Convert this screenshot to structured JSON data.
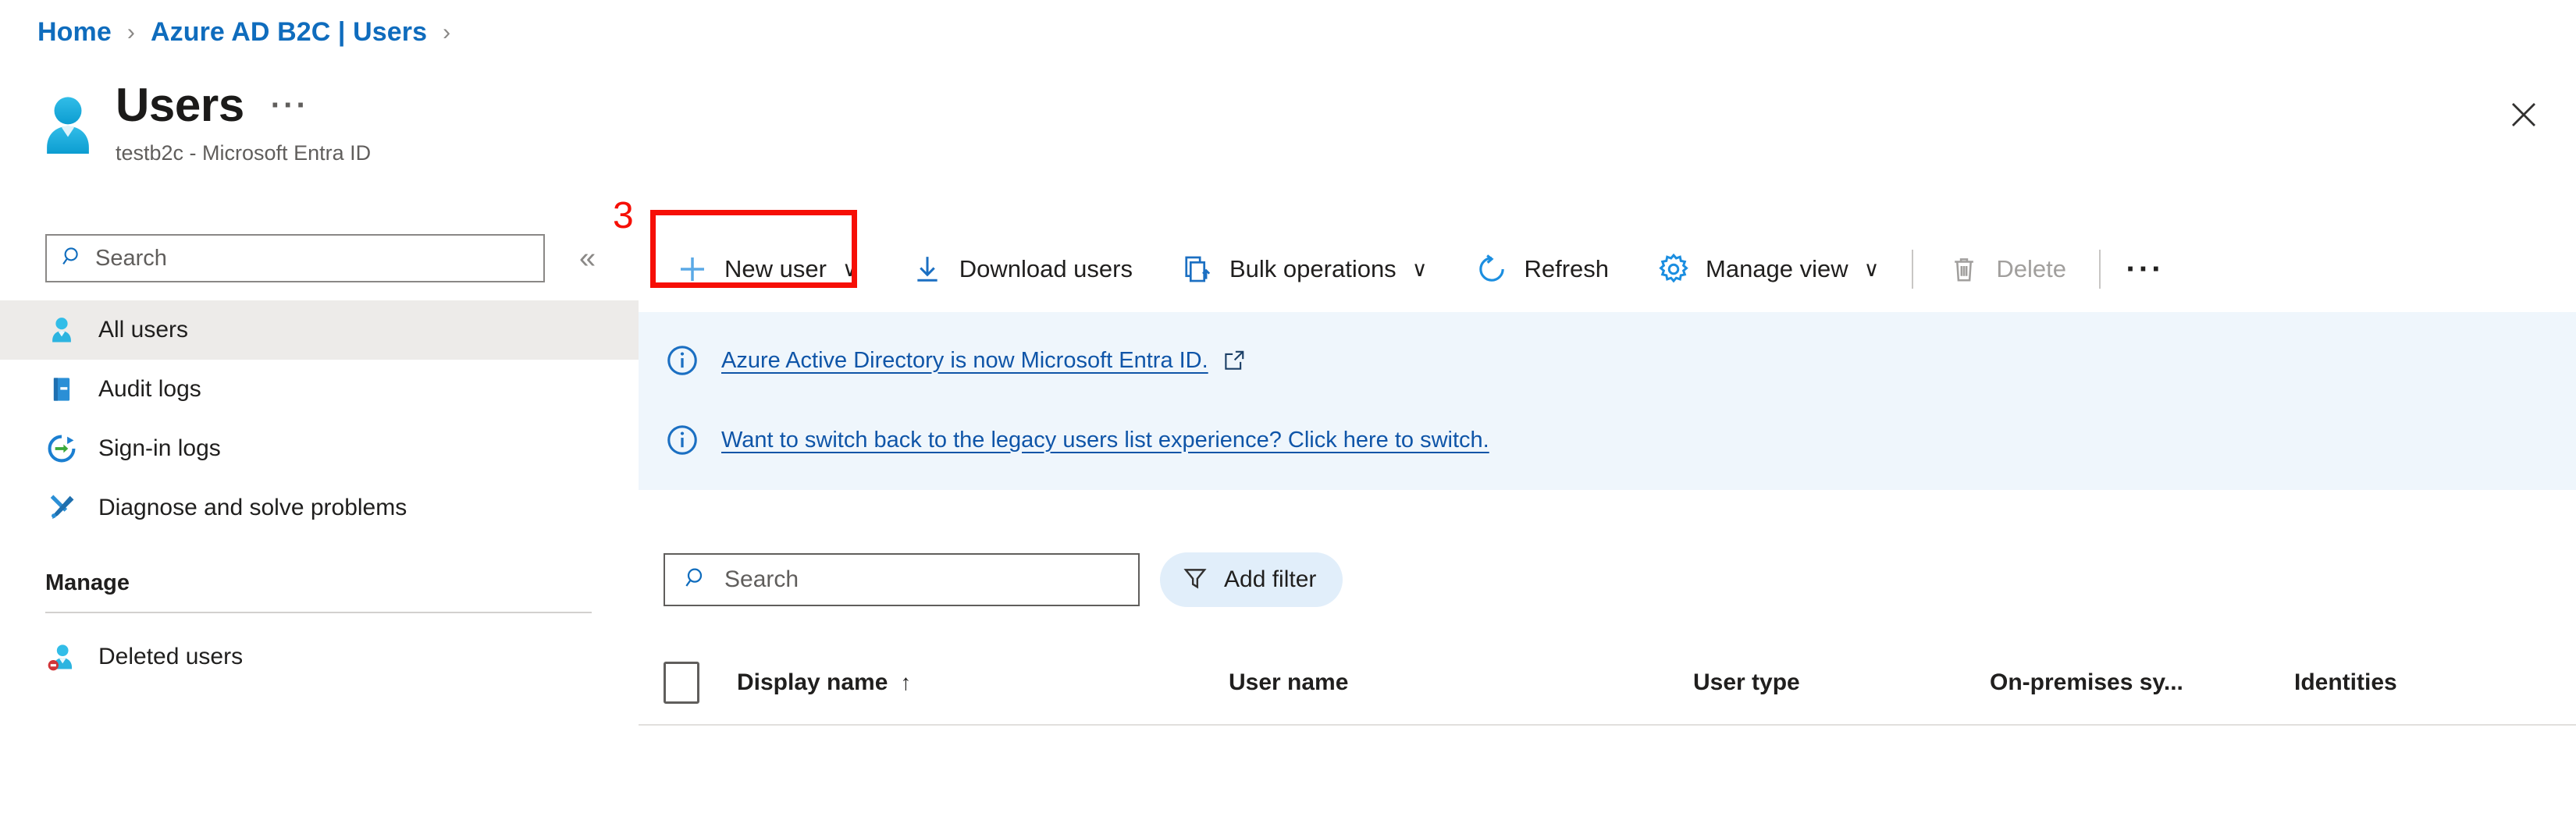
{
  "breadcrumb": {
    "items": [
      {
        "label": "Home"
      },
      {
        "label": "Azure AD B2C | Users"
      }
    ],
    "separator": "›"
  },
  "header": {
    "title": "Users",
    "subtitle": "testb2c - Microsoft Entra ID",
    "ellipsis_label": "···",
    "close_icon": "close-icon",
    "title_icon": "user-avatar-icon"
  },
  "sidebar": {
    "search": {
      "placeholder": "Search",
      "value": "",
      "icon": "search-icon"
    },
    "collapse_label": "«",
    "items": [
      {
        "label": "All users",
        "icon": "user-icon",
        "selected": true
      },
      {
        "label": "Audit logs",
        "icon": "book-icon",
        "selected": false
      },
      {
        "label": "Sign-in logs",
        "icon": "sign-in-icon",
        "selected": false
      },
      {
        "label": "Diagnose and solve problems",
        "icon": "wrench-screwdriver-icon",
        "selected": false
      }
    ],
    "group_header": "Manage",
    "group_items": [
      {
        "label": "Deleted users",
        "icon": "deleted-user-icon",
        "selected": false
      }
    ]
  },
  "toolbar": {
    "new_user": {
      "label": "New user",
      "icon": "plus-icon",
      "caret": "∨"
    },
    "download_users": {
      "label": "Download users",
      "icon": "download-icon"
    },
    "bulk_operations": {
      "label": "Bulk operations",
      "icon": "bulk-operations-icon",
      "caret": "∨"
    },
    "refresh": {
      "label": "Refresh",
      "icon": "refresh-icon"
    },
    "manage_view": {
      "label": "Manage view",
      "icon": "gear-icon",
      "caret": "∨"
    },
    "delete": {
      "label": "Delete",
      "icon": "trash-icon",
      "disabled": true
    },
    "more": {
      "label": "···"
    }
  },
  "annotation": {
    "step_number": "3",
    "highlight_color": "#f60f06",
    "target": "new-user-button"
  },
  "banners": [
    {
      "icon": "info-icon",
      "text": "Azure Active Directory is now Microsoft Entra ID.",
      "external_link_icon": "external-link-icon",
      "has_external_icon": true
    },
    {
      "icon": "info-icon",
      "text": "Want to switch back to the legacy users list experience? Click here to switch.",
      "has_external_icon": false
    }
  ],
  "filter_bar": {
    "search": {
      "placeholder": "Search",
      "value": "",
      "icon": "search-icon"
    },
    "add_filter": {
      "label": "Add filter",
      "icon": "filter-icon"
    }
  },
  "table": {
    "select_all_checkbox": {
      "checked": false
    },
    "columns": [
      {
        "label": "Display name",
        "sort": "↑",
        "sorted": true
      },
      {
        "label": "User name",
        "sort": "",
        "sorted": false
      },
      {
        "label": "User type",
        "sort": "",
        "sorted": false
      },
      {
        "label": "On-premises sy...",
        "sort": "",
        "sorted": false
      },
      {
        "label": "Identities",
        "sort": "",
        "sorted": false
      }
    ],
    "rows": []
  },
  "colors": {
    "link_blue": "#0f6cbd",
    "banner_bg": "#eff6fc",
    "banner_link": "#0f55a8",
    "selected_row": "#edebe9",
    "accent_blue": "#0078d4",
    "annotation_red": "#f60f06",
    "pill_bg": "#e1eefa"
  }
}
